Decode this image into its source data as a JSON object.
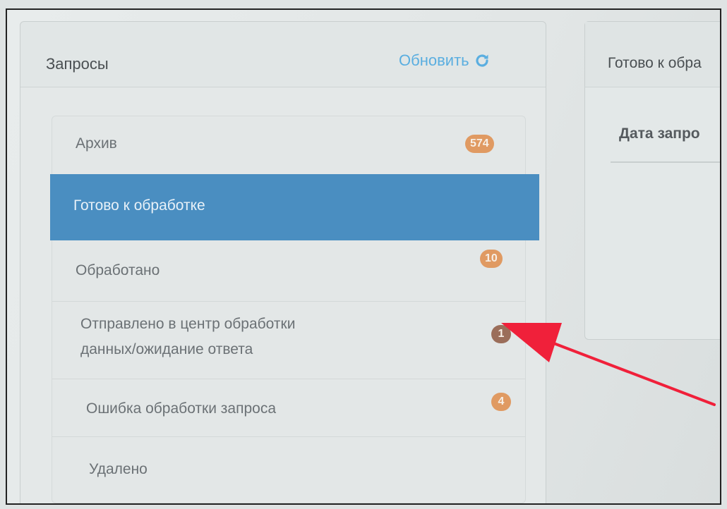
{
  "left_panel": {
    "title": "Запросы",
    "refresh_label": "Обновить"
  },
  "statuses": [
    {
      "label": "Архив",
      "count": "574"
    },
    {
      "label": "Готово к обработке",
      "count": ""
    },
    {
      "label": "Обработано",
      "count": "10"
    },
    {
      "label_line1": "Отправлено в центр обработки",
      "label_line2": "данных/ожидание ответа",
      "count": "1"
    },
    {
      "label": "Ошибка обработки запроса",
      "count": "4"
    },
    {
      "label": "Удалено",
      "count": ""
    }
  ],
  "right_panel": {
    "title": "Готово к обра",
    "column_header": "Дата запро"
  },
  "colors": {
    "active": "#4a8ec1",
    "badge": "#e09a62",
    "badge_dark": "#9b6e5a",
    "link": "#5aaee0",
    "annotation_arrow": "#f0203a"
  }
}
